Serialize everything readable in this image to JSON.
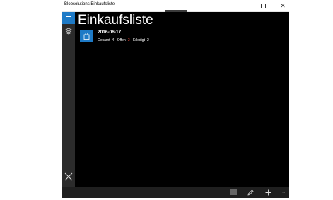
{
  "window": {
    "title": "Blobsolutions Einkaufsliste"
  },
  "page": {
    "title": "Einkaufsliste"
  },
  "list": {
    "items": [
      {
        "date": "2016-06-17",
        "gesamt_label": "Gesamt",
        "gesamt_value": "4",
        "offen_label": "Offen",
        "offen_value": "2",
        "erledigt_label": "Erledigt",
        "erledigt_value": "2"
      }
    ]
  },
  "icons": {
    "menu": "hamburger-icon",
    "lists": "layers-icon",
    "close": "close-icon",
    "item": "shopping-bag-icon",
    "appbar": [
      "list-icon",
      "pencil-icon",
      "plus-icon",
      "more-icon"
    ]
  },
  "appbar": {
    "more_label": "···"
  },
  "colors": {
    "accent": "#1e7ac6",
    "open_count": "#e84a3c",
    "background": "#000000"
  }
}
